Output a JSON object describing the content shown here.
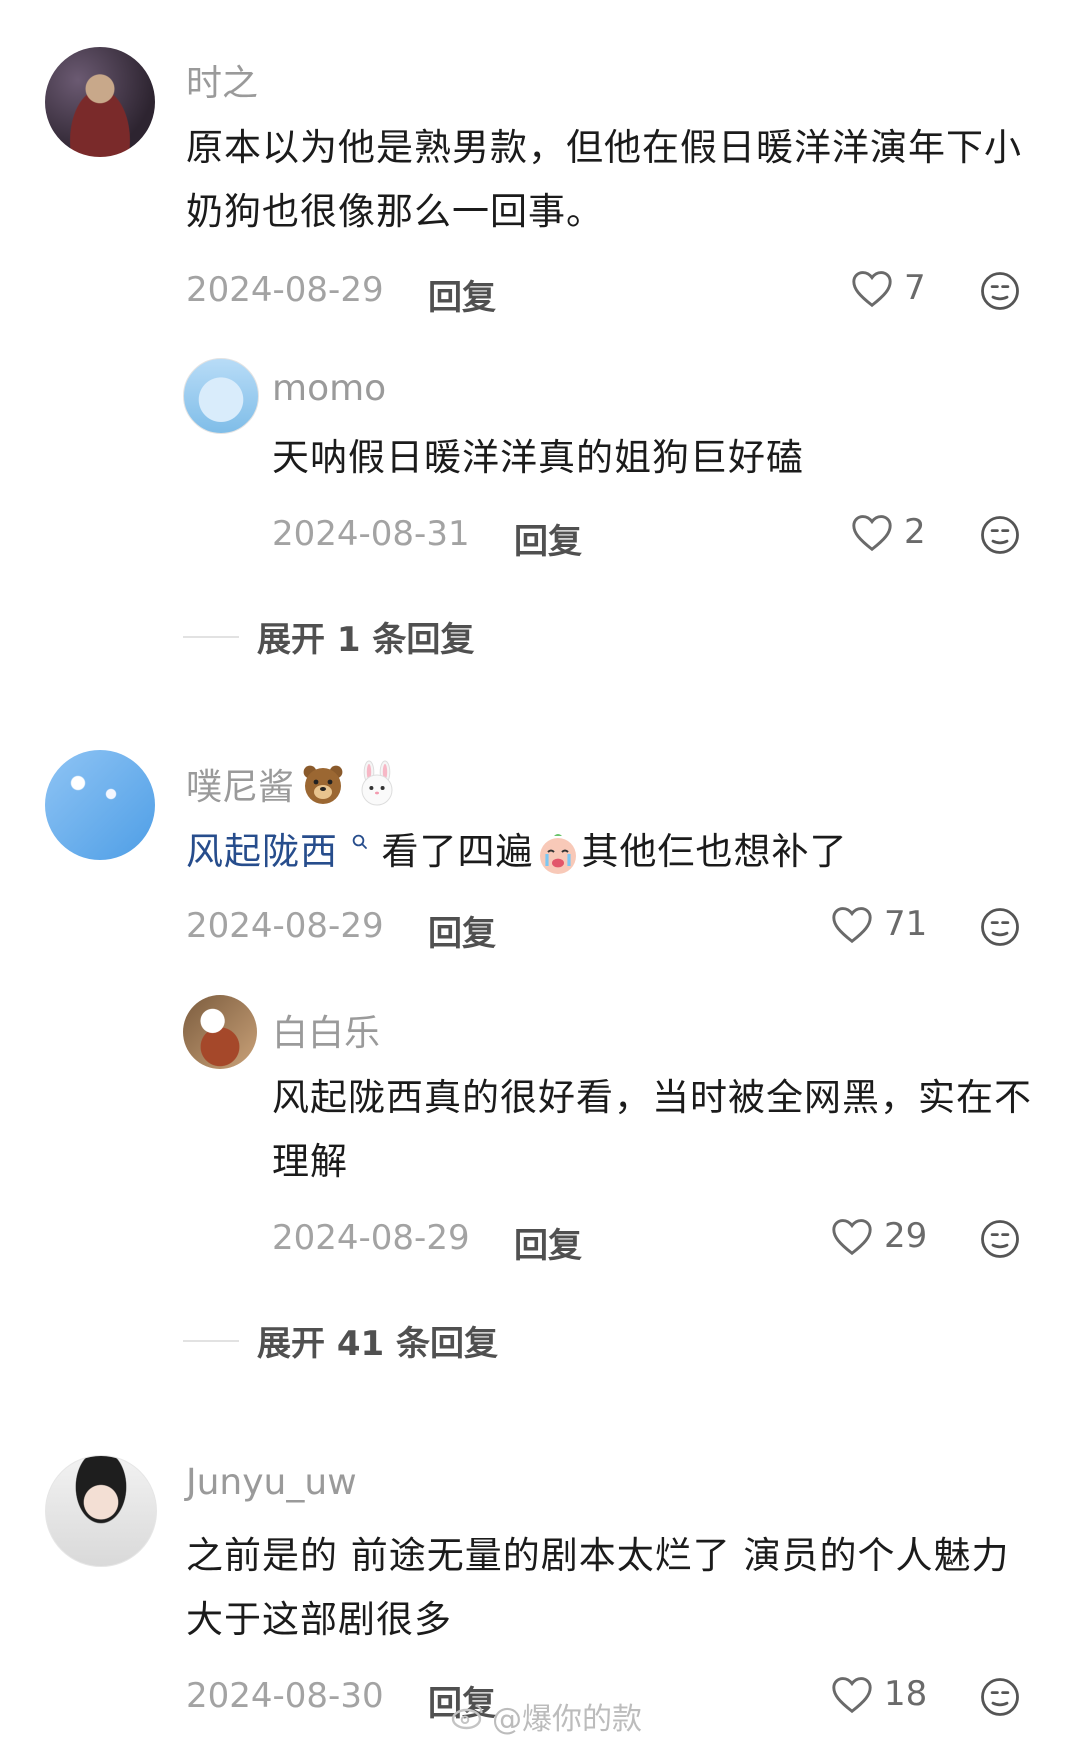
{
  "comments": [
    {
      "username": "时之",
      "content": "原本以为他是熟男款，但他在假日暖洋洋演年下小奶狗也很像那么一回事。",
      "date": "2024-08-29",
      "reply_label": "回复",
      "likes": "7",
      "replies": [
        {
          "username": "momo",
          "content": "天呐假日暖洋洋真的姐狗巨好磕",
          "date": "2024-08-31",
          "reply_label": "回复",
          "likes": "2"
        }
      ],
      "expand_label": "展开 1 条回复"
    },
    {
      "username": "噗尼酱",
      "username_emojis": [
        "bear-face-emoji",
        "rabbit-face-emoji"
      ],
      "content_link": "风起陇西",
      "content_after_link": "看了四遍",
      "content_tail": "其他仨也想补了",
      "date": "2024-08-29",
      "reply_label": "回复",
      "likes": "71",
      "replies": [
        {
          "username": "白白乐",
          "content": "风起陇西真的很好看，当时被全网黑，实在不理解",
          "date": "2024-08-29",
          "reply_label": "回复",
          "likes": "29"
        }
      ],
      "expand_label": "展开 41 条回复"
    },
    {
      "username": "Junyu_uw",
      "content": "之前是的 前途无量的剧本太烂了 演员的个人魅力大于这部剧很多",
      "date": "2024-08-30",
      "reply_label": "回复",
      "likes": "18"
    }
  ],
  "watermark": "@爆你的款",
  "colors": {
    "link": "#274d8c",
    "meta": "#a3a3a3",
    "username": "#9a9a9a"
  }
}
